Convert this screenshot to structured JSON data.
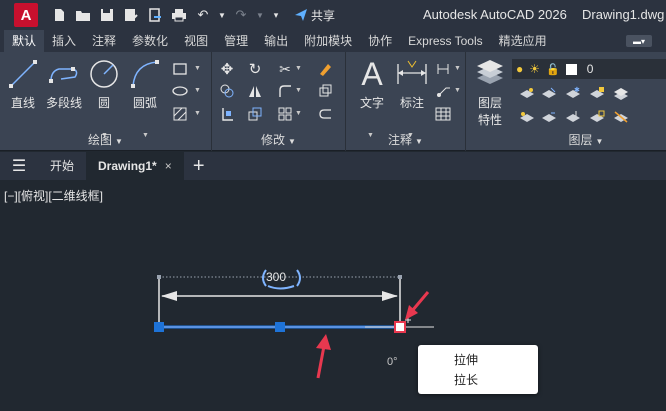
{
  "app": {
    "logo_letter": "A",
    "title": "Autodesk AutoCAD 2026",
    "document": "Drawing1.dwg",
    "share_label": "共享"
  },
  "ribbon_tabs": [
    "默认",
    "插入",
    "注释",
    "参数化",
    "视图",
    "管理",
    "输出",
    "附加模块",
    "协作",
    "Express Tools",
    "精选应用"
  ],
  "panels": {
    "draw": {
      "title": "绘图",
      "tools": [
        "直线",
        "多段线",
        "圆",
        "圆弧"
      ]
    },
    "modify": {
      "title": "修改"
    },
    "annotation": {
      "title": "注释",
      "tools": [
        "文字",
        "标注"
      ]
    },
    "layers": {
      "title": "图层",
      "layer_properties_label_1": "图层",
      "layer_properties_label_2": "特性",
      "current_layer": "0"
    }
  },
  "doc_tabs": {
    "start": "开始",
    "drawing": "Drawing1*",
    "close": "×",
    "add": "+"
  },
  "viewport_label": "[−][俯视][二维线框]",
  "drawing": {
    "dimension_value": "300",
    "angle_readout": "0°"
  },
  "context_menu": {
    "items": [
      "拉伸",
      "拉长"
    ]
  },
  "colors": {
    "accent": "#1e73d8",
    "annotation_arrow": "#e8384f",
    "canvas": "#212830"
  }
}
